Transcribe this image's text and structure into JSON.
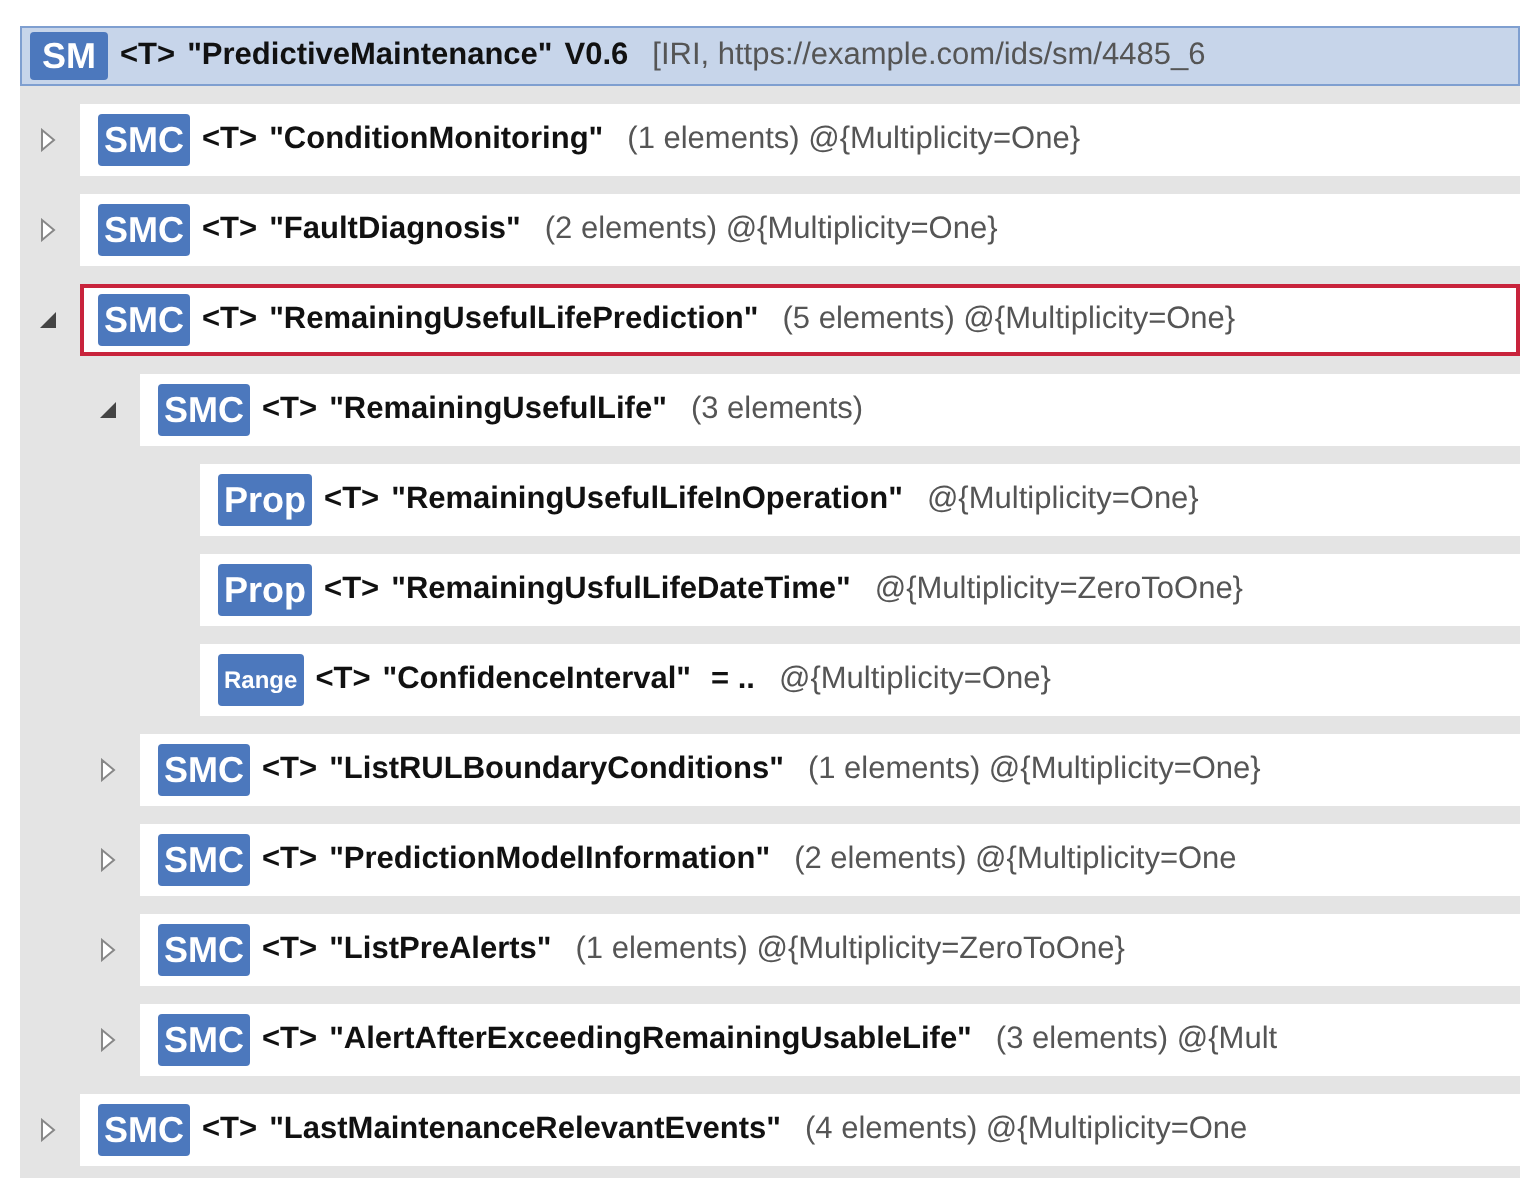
{
  "root": {
    "badge": "SM",
    "type": "<T>",
    "name": "\"PredictiveMaintenance\"",
    "version": "V0.6",
    "iri": "[IRI, https://example.com/ids/sm/4485_6"
  },
  "items": [
    {
      "badge": "SMC",
      "kind": "collection",
      "type": "<T>",
      "name": "\"ConditionMonitoring\"",
      "info": "(1 elements) @{Multiplicity=One}",
      "expanded": false,
      "selected": false
    },
    {
      "badge": "SMC",
      "kind": "collection",
      "type": "<T>",
      "name": "\"FaultDiagnosis\"",
      "info": "(2 elements) @{Multiplicity=One}",
      "expanded": false,
      "selected": false
    },
    {
      "badge": "SMC",
      "kind": "collection",
      "type": "<T>",
      "name": "\"RemainingUsefulLifePrediction\"",
      "info": "(5 elements) @{Multiplicity=One}",
      "expanded": true,
      "selected": true,
      "children": [
        {
          "badge": "SMC",
          "kind": "collection",
          "type": "<T>",
          "name": "\"RemainingUsefulLife\"",
          "info": "(3 elements)",
          "expanded": true,
          "selected": false,
          "children": [
            {
              "badge": "Prop",
              "kind": "property",
              "type": "<T>",
              "name": "\"RemainingUsefulLifeInOperation\"",
              "info": "@{Multiplicity=One}",
              "selected": false
            },
            {
              "badge": "Prop",
              "kind": "property",
              "type": "<T>",
              "name": "\"RemainingUsfulLifeDateTime\"",
              "info": "@{Multiplicity=ZeroToOne}",
              "selected": false
            },
            {
              "badge": "Range",
              "kind": "range",
              "type": "<T>",
              "name": "\"ConfidenceInterval\"",
              "value": "=  ..",
              "info": "@{Multiplicity=One}",
              "selected": false
            }
          ]
        },
        {
          "badge": "SMC",
          "kind": "collection",
          "type": "<T>",
          "name": "\"ListRULBoundaryConditions\"",
          "info": "(1 elements) @{Multiplicity=One}",
          "expanded": false,
          "selected": false
        },
        {
          "badge": "SMC",
          "kind": "collection",
          "type": "<T>",
          "name": "\"PredictionModelInformation\"",
          "info": "(2 elements) @{Multiplicity=One",
          "expanded": false,
          "selected": false
        },
        {
          "badge": "SMC",
          "kind": "collection",
          "type": "<T>",
          "name": "\"ListPreAlerts\"",
          "info": "(1 elements) @{Multiplicity=ZeroToOne}",
          "expanded": false,
          "selected": false
        },
        {
          "badge": "SMC",
          "kind": "collection",
          "type": "<T>",
          "name": "\"AlertAfterExceedingRemainingUsableLife\"",
          "info": "(3 elements) @{Mult",
          "expanded": false,
          "selected": false
        }
      ]
    },
    {
      "badge": "SMC",
      "kind": "collection",
      "type": "<T>",
      "name": "\"LastMaintenanceRelevantEvents\"",
      "info": "(4 elements) @{Multiplicity=One",
      "expanded": false,
      "selected": false
    }
  ]
}
